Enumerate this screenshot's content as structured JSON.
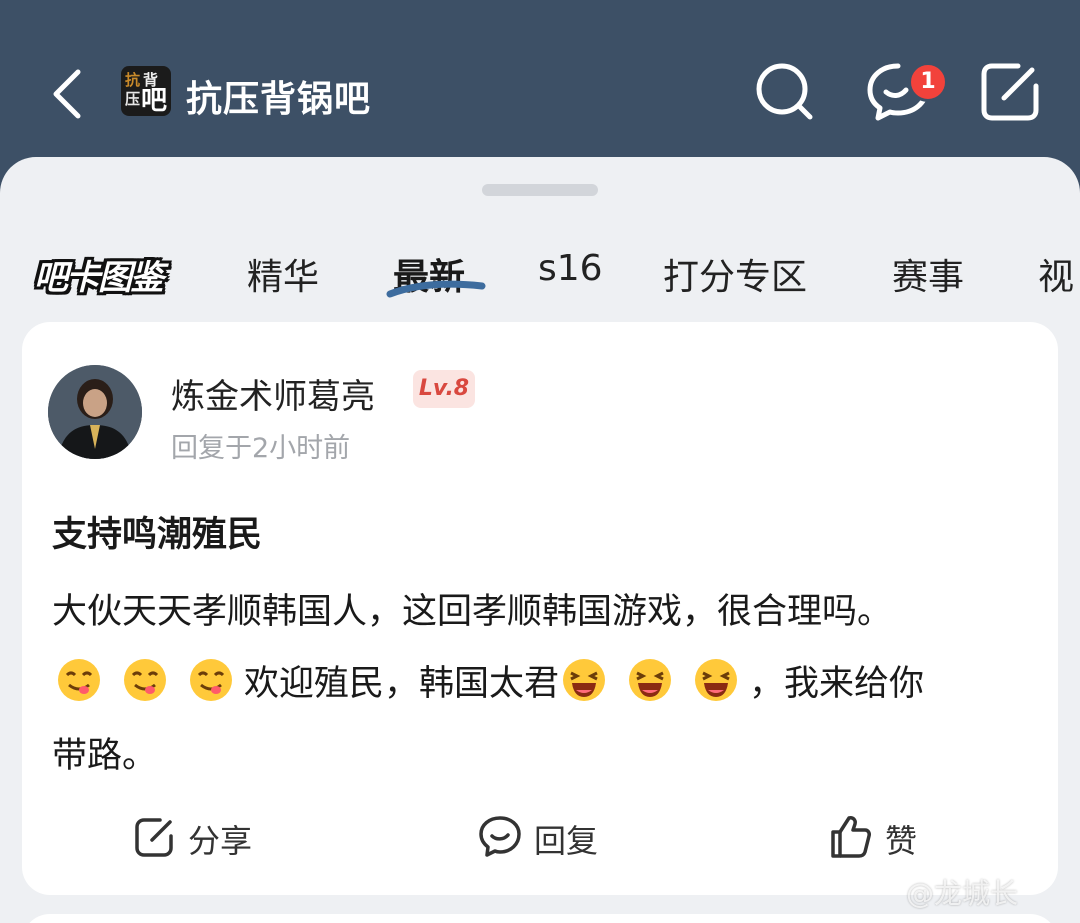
{
  "header": {
    "forum_name": "抗压背锅吧",
    "logo_text": [
      "抗",
      "背",
      "压",
      "吧"
    ],
    "notification_count": "1",
    "icons": [
      "back-arrow-icon",
      "search-icon",
      "message-bubble-icon",
      "edit-icon"
    ]
  },
  "tabs": {
    "card_label": "吧卡图鉴",
    "items": [
      "精华",
      "最新",
      "s16",
      "打分专区",
      "赛事",
      "视"
    ],
    "active": "最新"
  },
  "post": {
    "username": "炼金术师葛亮",
    "level": "Lv.8",
    "reply_time": "回复于2小时前",
    "title": "支持鸣潮殖民",
    "body_line1": "大伙天天孝顺韩国人，这回孝顺韩国游戏，很合理吗。",
    "body_mid": "欢迎殖民，韩国太君",
    "body_tail": "，我来给你",
    "body_line3": "带路。"
  },
  "actions": {
    "share": "分享",
    "reply": "回复",
    "like": "赞"
  },
  "watermark": "@龙城长",
  "colors": {
    "header_bg": "#3d5066",
    "sheet_bg": "#eef0f3",
    "badge_red": "#f2423b",
    "level_red": "#d9483f",
    "tab_underline": "#3d6c9e"
  }
}
